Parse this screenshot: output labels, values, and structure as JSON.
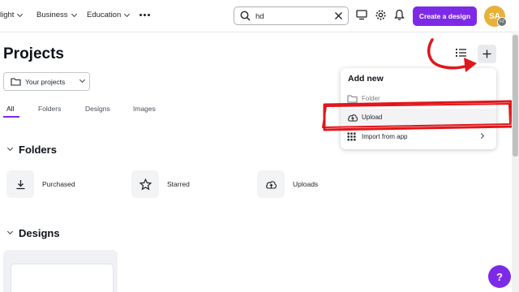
{
  "nav": {
    "items": [
      {
        "label": "light"
      },
      {
        "label": "Business"
      },
      {
        "label": "Education"
      }
    ],
    "more_icon": "more-dots-icon"
  },
  "search": {
    "value": "hd",
    "icon": "search-icon"
  },
  "toolbar": {
    "create_label": "Create a design",
    "avatar_initials": "SA",
    "avatar_badge": "FZ",
    "brand_color": "#7d2ae8",
    "icons": [
      "desktop-icon",
      "gear-icon",
      "bell-icon"
    ]
  },
  "page": {
    "title": "Projects",
    "filter_label": "Your projects",
    "tabs": [
      "All",
      "Folders",
      "Designs",
      "Images"
    ],
    "active_tab": "All"
  },
  "folders_section": {
    "title": "Folders",
    "items": [
      {
        "label": "Purchased",
        "icon": "download-icon"
      },
      {
        "label": "Starred",
        "icon": "star-icon"
      },
      {
        "label": "Uploads",
        "icon": "cloud-upload-icon"
      }
    ]
  },
  "designs_section": {
    "title": "Designs"
  },
  "add_new_menu": {
    "title": "Add new",
    "items": [
      {
        "label": "Folder",
        "icon": "folder-icon"
      },
      {
        "label": "Upload",
        "icon": "cloud-upload-icon"
      },
      {
        "label": "Import from app",
        "icon": "grid-apps-icon"
      }
    ]
  },
  "help": {
    "label": "?"
  },
  "annotation_color": "#e0161b"
}
